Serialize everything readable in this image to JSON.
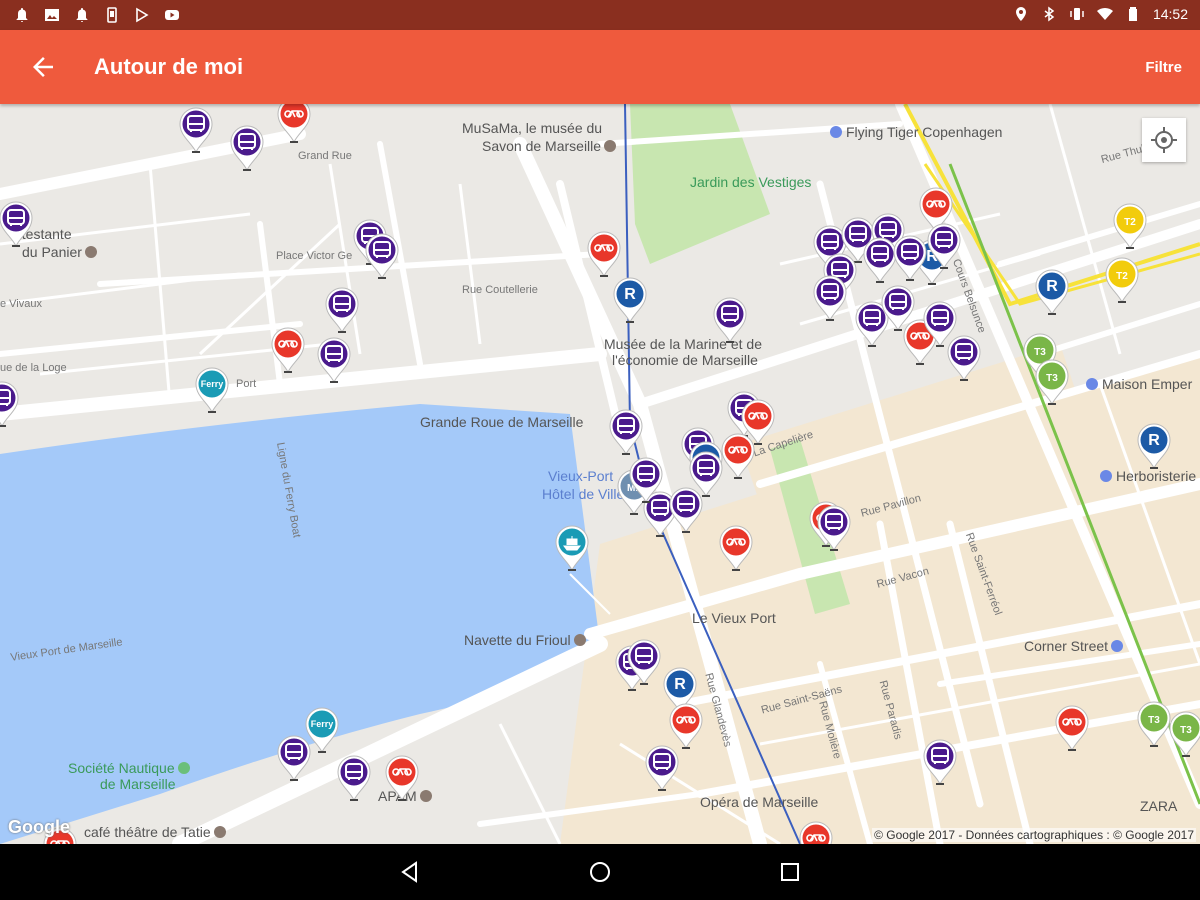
{
  "status_bar": {
    "time": "14:52",
    "left_icons": [
      "notification-icon",
      "image-icon",
      "notification-icon",
      "phone-icon",
      "play-store-icon",
      "youtube-icon"
    ],
    "right_icons": [
      "location-icon",
      "bluetooth-icon",
      "vibrate-icon",
      "wifi-icon",
      "battery-icon"
    ]
  },
  "app_bar": {
    "title": "Autour de moi",
    "filter_label": "Filtre",
    "color": "#ef5a3d"
  },
  "map": {
    "google_logo": "Google",
    "copyright": "© Google 2017 - Données cartographiques : © Google 2017",
    "water_color": "#a4c9f9",
    "labels": [
      {
        "id": "musama",
        "text": "MuSaMa, le musée du"
      },
      {
        "id": "savon",
        "text": "Savon de Marseille"
      },
      {
        "id": "flying",
        "text": "Flying Tiger Copenhagen"
      },
      {
        "id": "jardin",
        "text": "Jardin des Vestiges"
      },
      {
        "id": "grandrue",
        "text": "Grand Rue"
      },
      {
        "id": "protestante",
        "text": "otestante"
      },
      {
        "id": "panier",
        "text": "du Panier"
      },
      {
        "id": "victor",
        "text": "Place Victor Ge"
      },
      {
        "id": "coutellerie",
        "text": "Rue Coutellerie"
      },
      {
        "id": "vivaux",
        "text": "e Vivaux"
      },
      {
        "id": "loge",
        "text": "ue de la Loge"
      },
      {
        "id": "port",
        "text": "Port"
      },
      {
        "id": "musee1",
        "text": "Musée de la Marine et de"
      },
      {
        "id": "musee2",
        "text": "l'économie de Marseille"
      },
      {
        "id": "grande_roue",
        "text": "Grande Roue de Marseille"
      },
      {
        "id": "vieuxport_hv1",
        "text": "Vieux-Port"
      },
      {
        "id": "vieuxport_hv2",
        "text": "Hôtel de Ville"
      },
      {
        "id": "maison",
        "text": "Maison Emper"
      },
      {
        "id": "herbo",
        "text": "Herboristerie"
      },
      {
        "id": "capeliere",
        "text": "La Capelière"
      },
      {
        "id": "thubaneau",
        "text": "Rue Thubaneau"
      },
      {
        "id": "belsunce",
        "text": "Cours Belsunce"
      },
      {
        "id": "vacon",
        "text": "Rue Vacon"
      },
      {
        "id": "pavillon",
        "text": "Rue Pavillon"
      },
      {
        "id": "ferrari",
        "text": "Rue Saint-Ferréol"
      },
      {
        "id": "vieux_port",
        "text": "Le Vieux Port"
      },
      {
        "id": "navette",
        "text": "Navette du Frioul"
      },
      {
        "id": "corner",
        "text": "Corner Street"
      },
      {
        "id": "societe1",
        "text": "Société Nautique"
      },
      {
        "id": "societe2",
        "text": "de Marseille"
      },
      {
        "id": "saintsaens",
        "text": "Rue Saint-Saëns"
      },
      {
        "id": "opera",
        "text": "Opéra de Marseille"
      },
      {
        "id": "apam",
        "text": "APAM"
      },
      {
        "id": "cafe",
        "text": "café théâtre de Tatie"
      },
      {
        "id": "zara",
        "text": "ZARA"
      },
      {
        "id": "vieuxportdemarseille",
        "text": "Vieux Port de Marseille"
      },
      {
        "id": "ferrytext",
        "text": "Ligne du Ferry Boat"
      },
      {
        "id": "paradis",
        "text": "Rue Paradis"
      },
      {
        "id": "molière",
        "text": "Rue Molière"
      },
      {
        "id": "glandevès",
        "text": "Rue Glandevès"
      }
    ],
    "pin_legend": {
      "bus": "#4a1a8c",
      "bike": "#e8372a",
      "ferry": "#1a9bb5",
      "rtm": "#1c5aa6",
      "metro": "#6f8fb0",
      "tram_t2": "#f2cc0c",
      "tram_t3": "#7ab648",
      "boat": "#1a9bb5"
    },
    "pins": [
      {
        "type": "bus",
        "text": ""
      },
      {
        "type": "bike",
        "text": ""
      },
      {
        "type": "bus",
        "text": ""
      },
      {
        "type": "bus",
        "text": ""
      },
      {
        "type": "bus",
        "text": ""
      },
      {
        "type": "bus",
        "text": ""
      },
      {
        "type": "bus",
        "text": ""
      },
      {
        "type": "bike",
        "text": ""
      },
      {
        "type": "bus",
        "text": ""
      },
      {
        "type": "ferry",
        "text": "Ferry"
      },
      {
        "type": "bus",
        "text": ""
      },
      {
        "type": "bike",
        "text": ""
      },
      {
        "type": "rtm",
        "text": "R"
      },
      {
        "type": "bus",
        "text": ""
      },
      {
        "type": "bus",
        "text": ""
      },
      {
        "type": "bus",
        "text": ""
      },
      {
        "type": "bus",
        "text": ""
      },
      {
        "type": "bus",
        "text": ""
      },
      {
        "type": "bus",
        "text": ""
      },
      {
        "type": "bike",
        "text": ""
      },
      {
        "type": "rtm",
        "text": "R"
      },
      {
        "type": "bus",
        "text": ""
      },
      {
        "type": "bus",
        "text": ""
      },
      {
        "type": "bus",
        "text": ""
      },
      {
        "type": "bus",
        "text": ""
      },
      {
        "type": "bus",
        "text": ""
      },
      {
        "type": "bike",
        "text": ""
      },
      {
        "type": "bus",
        "text": ""
      },
      {
        "type": "bus",
        "text": ""
      },
      {
        "type": "tram_t2",
        "text": "T2"
      },
      {
        "type": "tram_t2",
        "text": "T2"
      },
      {
        "type": "rtm",
        "text": "R"
      },
      {
        "type": "tram_t3",
        "text": "T3"
      },
      {
        "type": "tram_t3",
        "text": "T3"
      },
      {
        "type": "rtm",
        "text": "R"
      },
      {
        "type": "bus",
        "text": ""
      },
      {
        "type": "bus",
        "text": ""
      },
      {
        "type": "bike",
        "text": ""
      },
      {
        "type": "bus",
        "text": ""
      },
      {
        "type": "rtm",
        "text": "R"
      },
      {
        "type": "bus",
        "text": ""
      },
      {
        "type": "bike",
        "text": ""
      },
      {
        "type": "bus",
        "text": ""
      },
      {
        "type": "metro",
        "text": "M1"
      },
      {
        "type": "bus",
        "text": ""
      },
      {
        "type": "bus",
        "text": ""
      },
      {
        "type": "bike",
        "text": ""
      },
      {
        "type": "bike",
        "text": ""
      },
      {
        "type": "bus",
        "text": ""
      },
      {
        "type": "boat",
        "text": ""
      },
      {
        "type": "bus",
        "text": ""
      },
      {
        "type": "bus",
        "text": ""
      },
      {
        "type": "rtm",
        "text": "R"
      },
      {
        "type": "bike",
        "text": ""
      },
      {
        "type": "bus",
        "text": ""
      },
      {
        "type": "ferry",
        "text": "Ferry"
      },
      {
        "type": "bus",
        "text": ""
      },
      {
        "type": "bus",
        "text": ""
      },
      {
        "type": "bike",
        "text": ""
      },
      {
        "type": "bike",
        "text": ""
      },
      {
        "type": "bike",
        "text": ""
      },
      {
        "type": "bus",
        "text": ""
      },
      {
        "type": "tram_t3",
        "text": "T3"
      },
      {
        "type": "tram_t3",
        "text": "T3"
      },
      {
        "type": "bike",
        "text": ""
      }
    ]
  },
  "nav_bar": {
    "buttons": [
      "back-icon",
      "home-icon",
      "recents-icon"
    ]
  }
}
